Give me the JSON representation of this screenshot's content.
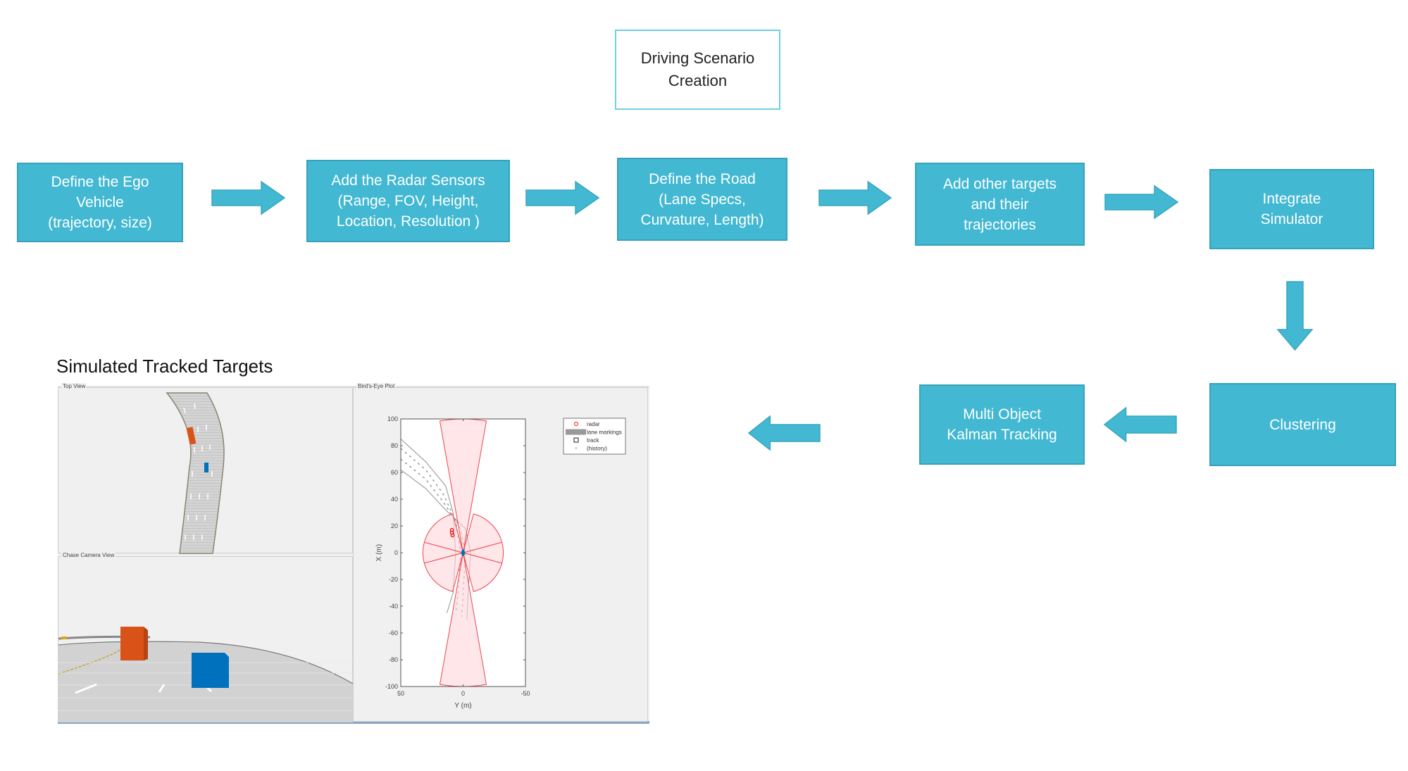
{
  "diagram": {
    "title_box": "Driving Scenario\nCreation",
    "steps": [
      {
        "id": "ego",
        "label": "Define the Ego\nVehicle\n(trajectory, size)"
      },
      {
        "id": "radar",
        "label": "Add the Radar Sensors\n(Range, FOV, Height,\nLocation, Resolution )"
      },
      {
        "id": "road",
        "label": "Define the Road\n(Lane Specs,\nCurvature, Length)"
      },
      {
        "id": "targets",
        "label": "Add other targets\nand their\ntrajectories"
      },
      {
        "id": "simulator",
        "label": "Integrate\nSimulator"
      },
      {
        "id": "clustering",
        "label": "Clustering"
      },
      {
        "id": "tracking",
        "label": "Multi Object\nKalman Tracking"
      }
    ],
    "colors": {
      "box_fill": "#42b8d2",
      "box_border": "#37a2ba",
      "title_border": "#6fd0e2",
      "text_on_box": "#ffffff"
    }
  },
  "simulation": {
    "title": "Simulated Tracked Targets",
    "panels": {
      "top_view": "Top View",
      "chase_view": "Chase Camera View",
      "birds_eye": "Bird's-Eye Plot"
    },
    "vehicle_colors": {
      "ego": "#0072bd",
      "target": "#d95319"
    }
  },
  "chart_data": {
    "type": "scatter",
    "title": "Bird's-Eye Plot",
    "xlabel": "Y (m)",
    "ylabel": "X (m)",
    "xlim": [
      50,
      -50
    ],
    "ylim": [
      -100,
      100
    ],
    "xticks": [
      "50",
      "0",
      "-50"
    ],
    "yticks": [
      "100",
      "80",
      "60",
      "40",
      "20",
      "0",
      "-20",
      "-40",
      "-60",
      "-80",
      "-100"
    ],
    "legend": {
      "placement": "outside-top-right",
      "entries": [
        "radar",
        "lane markings",
        "track",
        "(history)"
      ]
    },
    "ego_position": {
      "x": 0,
      "y": 0
    },
    "target_detections": [
      {
        "x": 17,
        "y": 9
      },
      {
        "x": 15,
        "y": 9
      },
      {
        "x": 13,
        "y": 8.5
      }
    ],
    "radar_coverage": [
      {
        "name": "long-range-front",
        "range": 100,
        "azimuth_center": 0,
        "fov": 20
      },
      {
        "name": "long-range-rear",
        "range": 100,
        "azimuth_center": 180,
        "fov": 20
      },
      {
        "name": "short-range-left",
        "range": 30,
        "azimuth_center": 90,
        "fov": 30
      },
      {
        "name": "short-range-right",
        "range": 30,
        "azimuth_center": -90,
        "fov": 30
      },
      {
        "name": "mid-front-left",
        "range": 30,
        "azimuth_center": 45,
        "fov": 60
      },
      {
        "name": "mid-front-right",
        "range": 30,
        "azimuth_center": -45,
        "fov": 60
      },
      {
        "name": "mid-rear-left",
        "range": 30,
        "azimuth_center": 135,
        "fov": 60
      },
      {
        "name": "mid-rear-right",
        "range": 30,
        "azimuth_center": -135,
        "fov": 60
      }
    ],
    "colors": {
      "coverage_fill": "#ffd6d8",
      "coverage_stroke": "#f0444f",
      "lane": "#9a9a9a"
    }
  }
}
